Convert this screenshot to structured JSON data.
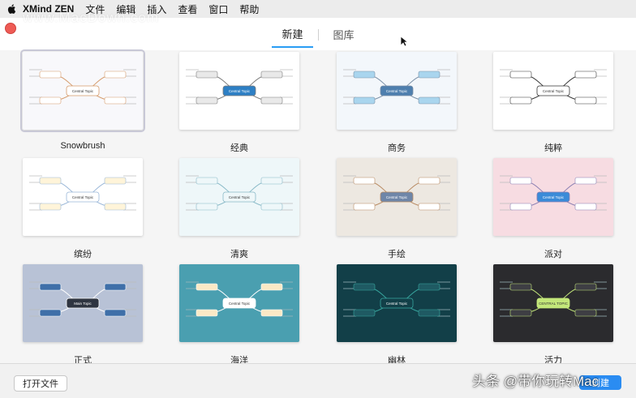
{
  "menubar": {
    "app_name": "XMind ZEN",
    "items": [
      "文件",
      "编辑",
      "插入",
      "查看",
      "窗口",
      "帮助"
    ]
  },
  "tabs": [
    {
      "label": "新建",
      "active": true
    },
    {
      "label": "图库",
      "active": false
    }
  ],
  "templates": [
    {
      "name": "Snowbrush",
      "bg": "#f8f8fb",
      "center": "#ffffff",
      "sub": "#ffffff",
      "line": "#d59a6a",
      "center_text": "Central Topic",
      "selected": true
    },
    {
      "name": "经典",
      "bg": "#ffffff",
      "center": "#2d7fc4",
      "sub": "#e9e9e9",
      "line": "#7a7a7a",
      "center_text": "Central Topic",
      "selected": false
    },
    {
      "name": "商务",
      "bg": "#f3f7fb",
      "center": "#4e7fae",
      "sub": "#a9d5ee",
      "line": "#7a8fa6",
      "center_text": "Central Topic",
      "selected": false
    },
    {
      "name": "纯粹",
      "bg": "#ffffff",
      "center": "#ffffff",
      "sub": "#ffffff",
      "line": "#333333",
      "center_text": "Central Topic",
      "selected": false
    },
    {
      "name": "缤纷",
      "bg": "#ffffff",
      "center": "#ffffff",
      "sub": "#fff4d9",
      "line": "#9ab7d8",
      "center_text": "Central Topic",
      "selected": false
    },
    {
      "name": "清爽",
      "bg": "#eef7f9",
      "center": "#eef7f9",
      "sub": "#eef7f9",
      "line": "#88b9c7",
      "center_text": "Central Topic",
      "selected": false
    },
    {
      "name": "手绘",
      "bg": "#ede8e1",
      "center": "#6f86a8",
      "sub": "#ffffff",
      "line": "#b88a62",
      "center_text": "Central Topic",
      "selected": false
    },
    {
      "name": "派对",
      "bg": "#f7dce2",
      "center": "#3b8bd8",
      "sub": "#ffffff",
      "line": "#8a7fb2",
      "center_text": "Central Topic",
      "selected": false
    },
    {
      "name": "正式",
      "bg": "#b8c2d6",
      "center": "#2f3541",
      "sub": "#3f6fa8",
      "line": "#ffffff",
      "center_text": "Main Topic",
      "selected": false
    },
    {
      "name": "海洋",
      "bg": "#4a9fb0",
      "center": "#ffffff",
      "sub": "#fbe9c6",
      "line": "#ffffff",
      "center_text": "Central Topic",
      "selected": false
    },
    {
      "name": "幽林",
      "bg": "#123f48",
      "center": "#123f48",
      "sub": "#1f5a63",
      "line": "#38a8a0",
      "center_text": "Central Topic",
      "selected": false
    },
    {
      "name": "活力",
      "bg": "#2b2b2e",
      "center": "#c3e77a",
      "sub": "#3e3e44",
      "line": "#c3e77a",
      "center_text": "CENTRAL TOPIC",
      "selected": false
    }
  ],
  "footer": {
    "open_label": "打开文件",
    "create_label": "创建"
  },
  "watermark": "www.MacDown.com",
  "corner_watermark": "头条 @带你玩转Mac"
}
